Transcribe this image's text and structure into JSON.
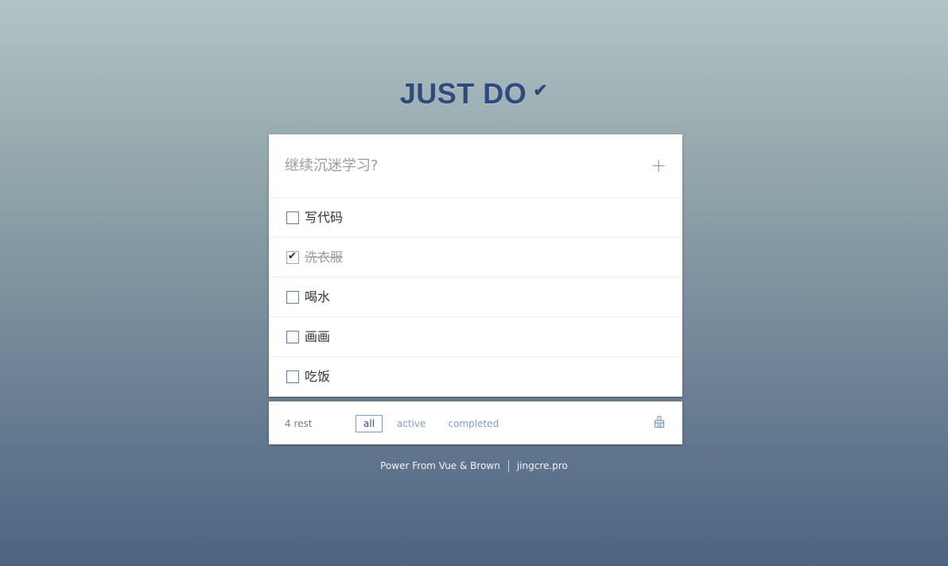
{
  "app": {
    "title": "JUST DO",
    "title_check": "✔"
  },
  "new_todo": {
    "placeholder": "继续沉迷学习?",
    "value": "",
    "add_label": "+"
  },
  "todos": [
    {
      "text": "写代码",
      "done": false
    },
    {
      "text": "洗衣服",
      "done": true
    },
    {
      "text": "喝水",
      "done": false
    },
    {
      "text": "画画",
      "done": false
    },
    {
      "text": "吃饭",
      "done": false
    }
  ],
  "footer": {
    "rest_label": "4 rest",
    "filters": [
      {
        "label": "all",
        "selected": true
      },
      {
        "label": "active",
        "selected": false
      },
      {
        "label": "completed",
        "selected": false
      }
    ],
    "clear_icon": "broom-icon"
  },
  "credits": {
    "power": "Power From Vue & Brown",
    "site": "jingcre.pro"
  },
  "colors": {
    "accent": "#7d9ccb",
    "title": "#2f4a7d",
    "background_top": "#b1c5c7",
    "background_bottom": "#4d6381"
  }
}
